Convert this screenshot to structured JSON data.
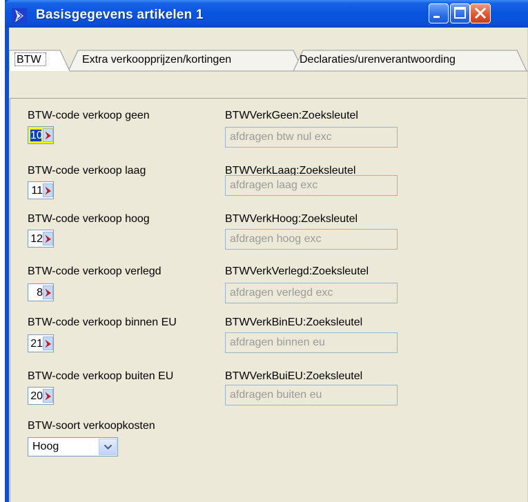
{
  "window": {
    "title": "Basisgegevens artikelen 1",
    "titlebar_color": "#0a55e0",
    "close_color": "#e0582f",
    "icons": [
      "app-icon",
      "minimize-icon",
      "maximize-icon",
      "close-icon"
    ]
  },
  "tabs": [
    {
      "label": "BTW",
      "active": true
    },
    {
      "label": "Extra verkoopprijzen/kortingen",
      "active": false
    },
    {
      "label": "Declaraties/urenverantwoording",
      "active": false
    }
  ],
  "fields": [
    {
      "label": "BTW-code verkoop geen",
      "code": "10",
      "lookup_label": "BTWVerkGeen:Zoeksleutel",
      "lookup_value": "afdragen btw nul exc",
      "focused": true
    },
    {
      "label": "BTW-code verkoop laag",
      "code": "11",
      "lookup_label": "BTWVerkLaag:Zoeksleutel",
      "lookup_value": "afdragen laag exc",
      "focused": false
    },
    {
      "label": "BTW-code verkoop hoog",
      "code": "12",
      "lookup_label": "BTWVerkHoog:Zoeksleutel",
      "lookup_value": "afdragen hoog exc",
      "focused": false
    },
    {
      "label": "BTW-code verkoop verlegd",
      "code": "8",
      "lookup_label": "BTWVerkVerlegd:Zoeksleutel",
      "lookup_value": "afdragen verlegd exc",
      "focused": false
    },
    {
      "label": "BTW-code verkoop binnen EU",
      "code": "21",
      "lookup_label": "BTWVerkBinEU:Zoeksleutel",
      "lookup_value": "afdragen binnen eu",
      "focused": false
    },
    {
      "label": "BTW-code verkoop buiten EU",
      "code": "20",
      "lookup_label": "BTWVerkBuiEU:Zoeksleutel",
      "lookup_value": "afdragen buiten eu",
      "focused": false
    }
  ],
  "verkoopkosten": {
    "label": "BTW-soort verkoopkosten",
    "selected": "Hoog"
  }
}
